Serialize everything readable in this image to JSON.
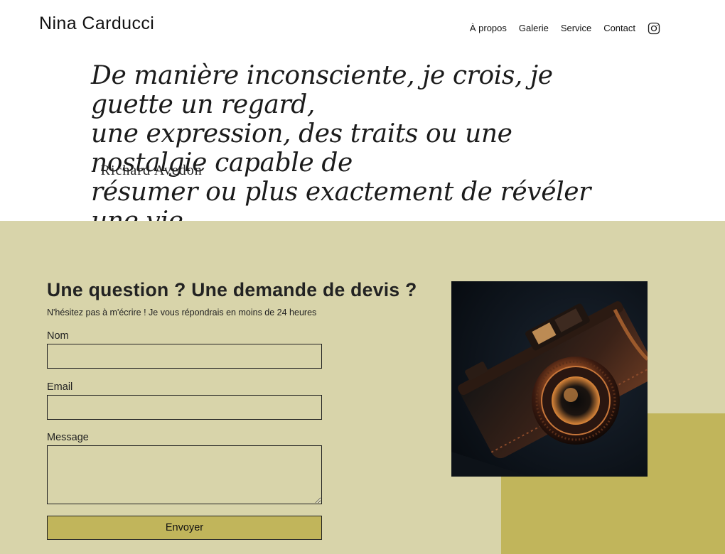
{
  "header": {
    "site_title": "Nina Carducci",
    "nav": [
      "À propos",
      "Galerie",
      "Service",
      "Contact"
    ],
    "social_icon": "instagram-icon"
  },
  "quote": {
    "lines": [
      "De manière inconsciente, je crois, je guette un regard,",
      "une expression, des traits ou une nostalgie capable de",
      "résumer ou plus exactement de révéler une vie"
    ],
    "author": "- Richard Avedon"
  },
  "contact": {
    "title": "Une question ? Une demande de devis ?",
    "subtitle": "N'hésitez pas à m'écrire ! Je vous répondrais en moins de 24 heures",
    "fields": {
      "name_label": "Nom",
      "name_value": "",
      "email_label": "Email",
      "email_value": "",
      "message_label": "Message",
      "message_value": ""
    },
    "submit_label": "Envoyer",
    "image_icon": "camera-photo"
  },
  "colors": {
    "band_bg": "#d8d4aa",
    "accent": "#c1b55b",
    "text": "#111111"
  }
}
